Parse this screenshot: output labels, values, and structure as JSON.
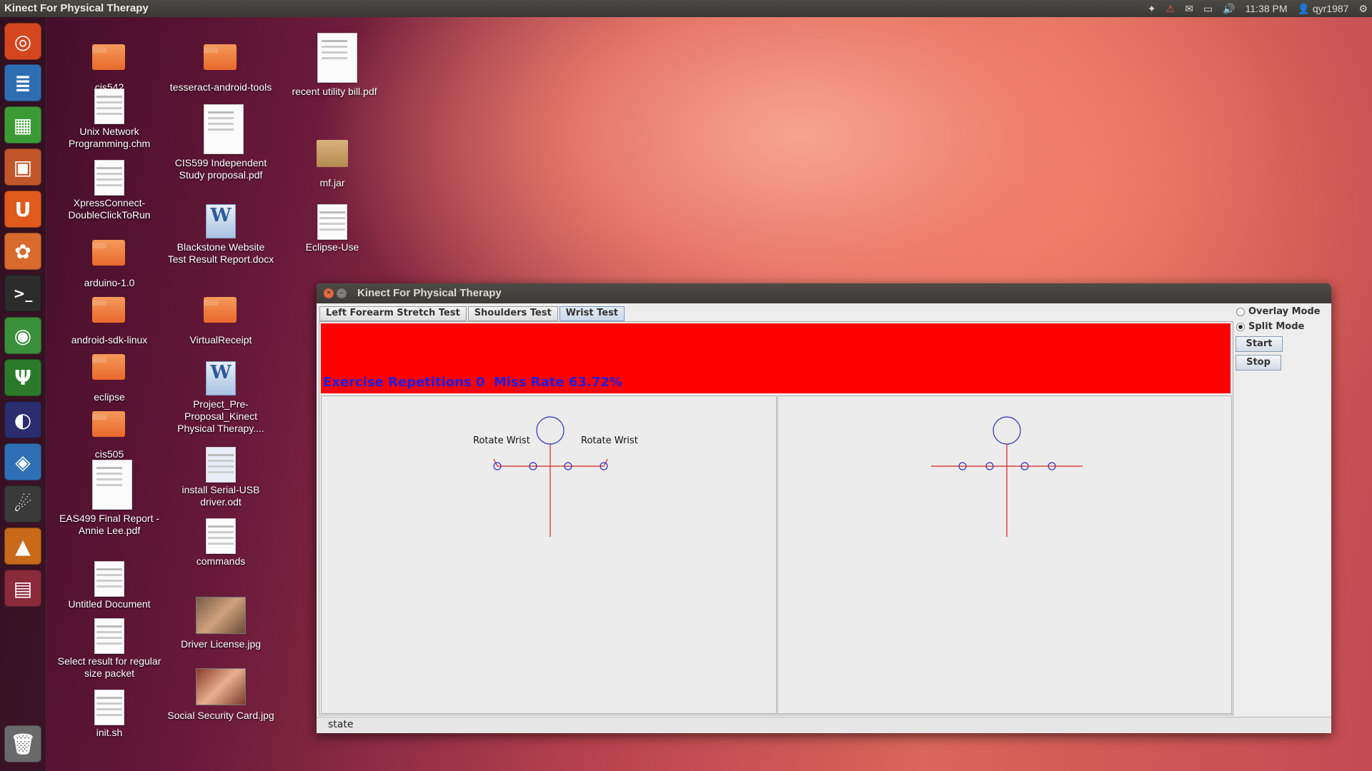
{
  "top_panel": {
    "app_title": "Kinect For Physical Therapy",
    "clock": "11:38 PM",
    "user": "qyr1987"
  },
  "launcher": {
    "items": [
      "ubuntu-dash",
      "libreoffice-writer",
      "libreoffice-calc",
      "libreoffice-impress",
      "ubuntu-one",
      "software-center",
      "terminal",
      "chrome",
      "network-tool",
      "eclipse",
      "virtualbox",
      "kinect-app",
      "matlab",
      "workspace-switcher",
      "trash"
    ]
  },
  "desktop": {
    "icons": [
      {
        "label": "cis542",
        "type": "folder"
      },
      {
        "label": "Unix Network Programming.chm",
        "type": "doc"
      },
      {
        "label": "XpressConnect-DoubleClickToRun",
        "type": "doc"
      },
      {
        "label": "arduino-1.0",
        "type": "folder"
      },
      {
        "label": "android-sdk-linux",
        "type": "folder"
      },
      {
        "label": "eclipse",
        "type": "folder"
      },
      {
        "label": "cis505",
        "type": "folder"
      },
      {
        "label": "EAS499 Final Report - Annie Lee.pdf",
        "type": "doc"
      },
      {
        "label": "Untitled Document",
        "type": "doc"
      },
      {
        "label": "Select result for regular size packet",
        "type": "doc"
      },
      {
        "label": "init.sh",
        "type": "doc"
      },
      {
        "label": "tesseract-android-tools",
        "type": "folder"
      },
      {
        "label": "CIS599 Independent Study proposal.pdf",
        "type": "doc"
      },
      {
        "label": "Blackstone Website Test Result Report.docx",
        "type": "word"
      },
      {
        "label": "VirtualReceipt",
        "type": "folder"
      },
      {
        "label": "Project_Pre-Proposal_Kinect Physical Therapy....",
        "type": "word"
      },
      {
        "label": "install Serial-USB driver.odt",
        "type": "doc"
      },
      {
        "label": "commands",
        "type": "doc"
      },
      {
        "label": "Driver License.jpg",
        "type": "photo"
      },
      {
        "label": "Social Security Card.jpg",
        "type": "photo"
      },
      {
        "label": "recent utility bill.pdf",
        "type": "doc"
      },
      {
        "label": "mf.jar",
        "type": "pkg"
      },
      {
        "label": "Eclipse-Use",
        "type": "doc"
      }
    ]
  },
  "window": {
    "title": "Kinect For Physical Therapy",
    "tabs": [
      {
        "label": "Left Forearm Stretch Test"
      },
      {
        "label": "Shoulders Test"
      },
      {
        "label": "Wrist Test"
      }
    ],
    "active_tab": "Wrist Test",
    "banner": {
      "color": "#ff0000",
      "stats_text": "Exercise Repetitions 0  Miss Rate 63.72%"
    },
    "left_panel": {
      "label_left": "Rotate Wrist",
      "label_right": "Rotate Wrist"
    },
    "side": {
      "overlay_label": "Overlay Mode",
      "split_label": "Split Mode",
      "selected_mode": "Split Mode",
      "start_label": "Start",
      "stop_label": "Stop"
    },
    "status": "state"
  },
  "colors": {
    "skeleton_line": "#e02020",
    "joint": "#3030c0",
    "banner": "#ff0000"
  }
}
